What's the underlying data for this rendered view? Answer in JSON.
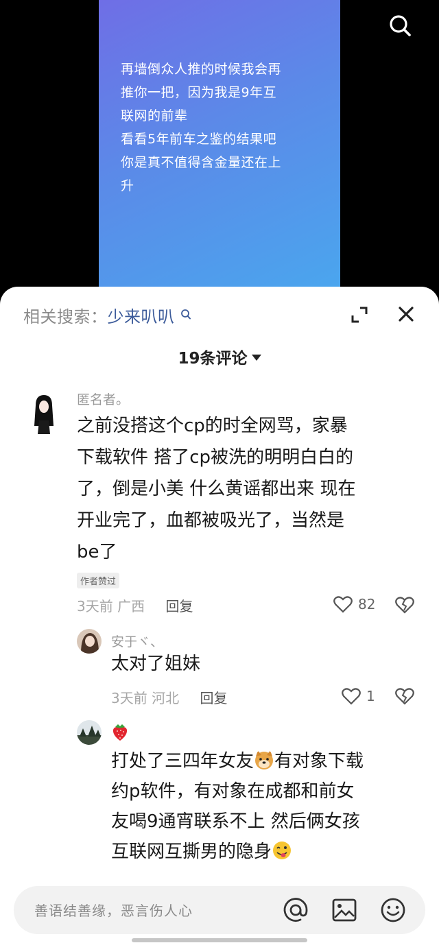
{
  "video": {
    "lines": [
      "再墙倒众人推的时候我会再",
      "推你一把，因为我是9年互",
      "联网的前辈",
      "看看5年前车之鉴的结果吧",
      "你是真不值得含金量还在上",
      "升"
    ]
  },
  "panel": {
    "related_label": "相关搜索：",
    "related_keyword": "少来叭叭",
    "comment_count": "19条评论"
  },
  "comments": [
    {
      "name": "匿名者。",
      "lines": [
        "之前没搭这个cp的时全网骂，家暴",
        "下载软件 搭了cp被洗的明明白白的",
        "了，倒是小美 什么黄谣都出来 现在",
        "开业完了，血都被吸光了，当然是",
        "be了"
      ],
      "badge": "作者赞过",
      "time": "3天前",
      "location": "广西",
      "reply": "回复",
      "likes": "82"
    },
    {
      "name": "安于ヾ、",
      "lines": [
        "太对了姐妹"
      ],
      "time": "3天前",
      "location": "河北",
      "reply": "回复",
      "likes": "1"
    },
    {
      "name_emoji": "strawberry-emoji",
      "line1_a": "打处了三四年女友",
      "line1_b": "有对象下载",
      "lines_mid": [
        "约p软件，有对象在成都和前女",
        "友喝9通宵联系不上 然后俩女孩"
      ],
      "line_last": "互联网互撕男的隐身"
    }
  ],
  "input": {
    "placeholder": "善语结善缘，恶言伤人心"
  },
  "colors": {
    "accent_link": "#3c5b9a",
    "video_gradient": [
      "#6f6ee6",
      "#4aa6ee"
    ]
  }
}
